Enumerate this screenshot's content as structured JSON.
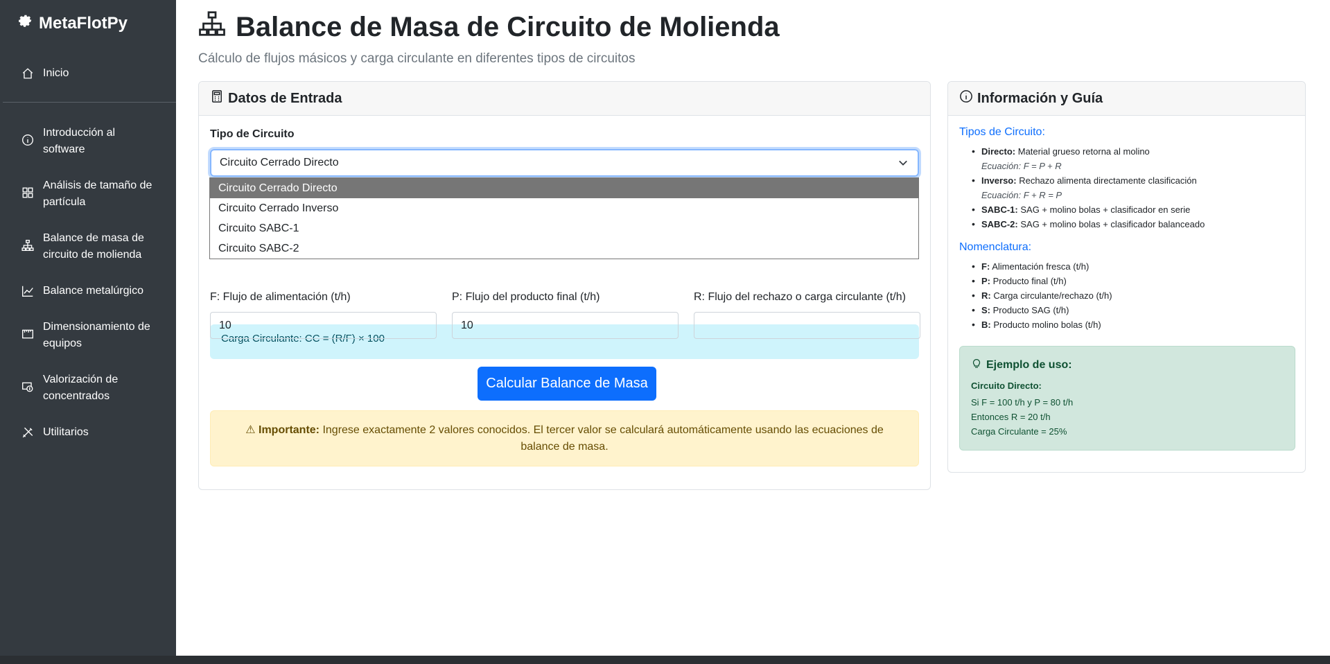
{
  "brand": {
    "name": "MetaFlotPy"
  },
  "sidebar": {
    "items": [
      {
        "label": "Inicio",
        "icon": "home-icon"
      },
      {
        "label_line1": "Introducción al",
        "label_line2": "software",
        "icon": "info-icon"
      },
      {
        "label_line1": "Análisis de tamaño de",
        "label_line2": "partícula",
        "icon": "grid-icon"
      },
      {
        "label_line1": "Balance de masa de",
        "label_line2": "circuito de molienda",
        "icon": "diagram-icon"
      },
      {
        "label": "Balance metalúrgico",
        "icon": "chart-line-icon"
      },
      {
        "label_line1": "Dimensionamiento de",
        "label_line2": "equipos",
        "icon": "ruler-icon"
      },
      {
        "label_line1": "Valorización de",
        "label_line2": "concentrados",
        "icon": "cash-icon"
      },
      {
        "label": "Utilitarios",
        "icon": "tools-icon"
      }
    ]
  },
  "page": {
    "title": "Balance de Masa de Circuito de Molienda",
    "subtitle": "Cálculo de flujos másicos y carga circulante en diferentes tipos de circuitos"
  },
  "input_card": {
    "header": "Datos de Entrada",
    "circuit_label": "Tipo de Circuito",
    "circuit_selected": "Circuito Cerrado Directo",
    "options": [
      "Circuito Cerrado Directo",
      "Circuito Cerrado Inverso",
      "Circuito SABC-1",
      "Circuito SABC-2"
    ],
    "info_partial": "Carga Circulante: CC = (R/F) × 100",
    "fields": [
      {
        "label": "F: Flujo de alimentación (t/h)",
        "value": "10"
      },
      {
        "label": "P: Flujo del producto final (t/h)",
        "value": "10"
      },
      {
        "label": "R: Flujo del rechazo o carga circulante (t/h)",
        "value": ""
      }
    ],
    "button": "Calcular Balance de Masa",
    "warning_bold": "Importante:",
    "warning_text": "Ingrese exactamente 2 valores conocidos. El tercer valor se calculará automáticamente usando las ecuaciones de balance de masa."
  },
  "guide_card": {
    "header": "Información y Guía",
    "types_heading": "Tipos de Circuito:",
    "types": [
      {
        "name": "Directo:",
        "desc": "Material grueso retorna al molino",
        "eq": "Ecuación: F = P + R"
      },
      {
        "name": "Inverso:",
        "desc": "Rechazo alimenta directamente clasificación",
        "eq": "Ecuación: F + R = P"
      },
      {
        "name": "SABC-1:",
        "desc": "SAG + molino bolas + clasificador en serie",
        "eq": ""
      },
      {
        "name": "SABC-2:",
        "desc": "SAG + molino bolas + clasificador balanceado",
        "eq": ""
      }
    ],
    "nomen_heading": "Nomenclatura:",
    "nomen": [
      {
        "k": "F:",
        "v": "Alimentación fresca (t/h)"
      },
      {
        "k": "P:",
        "v": "Producto final (t/h)"
      },
      {
        "k": "R:",
        "v": "Carga circulante/rechazo (t/h)"
      },
      {
        "k": "S:",
        "v": "Producto SAG (t/h)"
      },
      {
        "k": "B:",
        "v": "Producto molino bolas (t/h)"
      }
    ],
    "example": {
      "heading": "Ejemplo de uso:",
      "sub": "Circuito Directo:",
      "lines": [
        "Si F = 100 t/h y P = 80 t/h",
        "Entonces R = 20 t/h",
        "Carga Circulante = 25%"
      ]
    }
  },
  "colors": {
    "sidebar": "#343a40",
    "primary": "#0d6efd",
    "info_bg": "#cff4fc",
    "warning_bg": "#fff3cd",
    "success_bg": "#d1e7dd"
  }
}
